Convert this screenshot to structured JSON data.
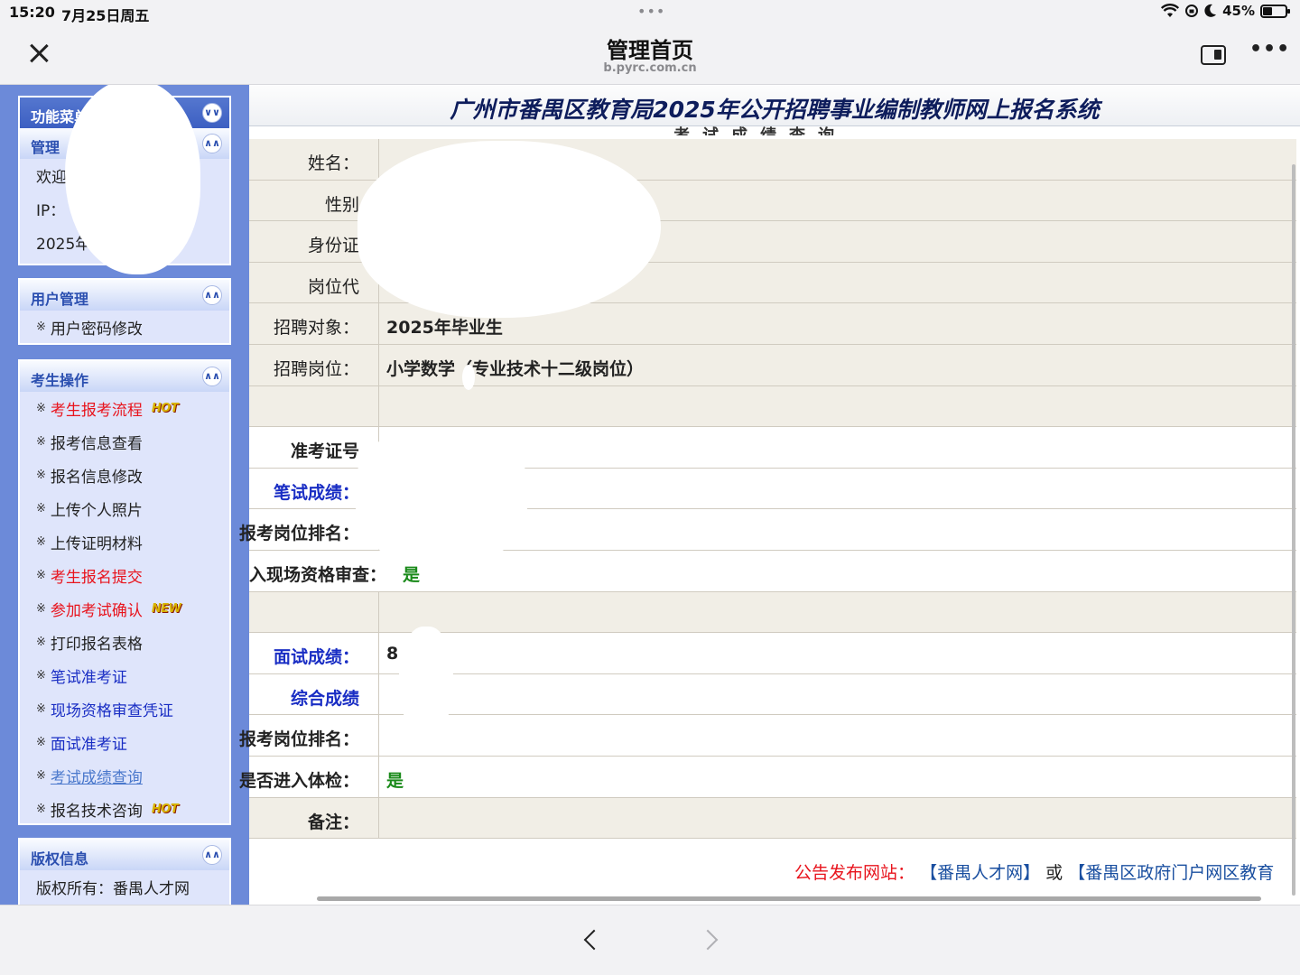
{
  "status": {
    "time": "15:20",
    "date": "7月25日周五",
    "dots": "•••",
    "battery_percent": "45%",
    "battery_level": 0.45
  },
  "browser": {
    "title": "管理首页",
    "url": "b.pyrc.com.cn",
    "more": "•••"
  },
  "sidebar": {
    "menu_title": "功能菜单",
    "admin_panel": {
      "title": "管理",
      "rows": [
        "欢迎",
        "IP：",
        "2025年"
      ]
    },
    "user_panel": {
      "title": "用户管理",
      "items": [
        "用户密码修改"
      ]
    },
    "exam_panel": {
      "title": "考生操作",
      "items": [
        {
          "label": "考生报考流程",
          "badge": "HOT"
        },
        {
          "label": "报考信息查看"
        },
        {
          "label": "报名信息修改"
        },
        {
          "label": "上传个人照片"
        },
        {
          "label": "上传证明材料"
        },
        {
          "label": "考生报名提交"
        },
        {
          "label": "参加考试确认",
          "badge": "NEW"
        },
        {
          "label": "打印报名表格"
        },
        {
          "label": "笔试准考证"
        },
        {
          "label": "现场资格审查凭证"
        },
        {
          "label": "面试准考证"
        },
        {
          "label": "考试成绩查询"
        },
        {
          "label": "报名技术咨询",
          "badge": "HOT"
        }
      ]
    },
    "copyright_panel": {
      "title": "版权信息",
      "text": "版权所有：番禺人才网"
    },
    "bullet": "※"
  },
  "main": {
    "banner_title": "广州市番禺区教育局2025年公开招聘事业编制教师网上报名系统",
    "subheading": "考试成绩查询",
    "rows": [
      {
        "label": "姓名：",
        "value": ""
      },
      {
        "label": "性别",
        "value": ""
      },
      {
        "label": "身份证",
        "value": ""
      },
      {
        "label": "岗位代",
        "value": ""
      },
      {
        "label": "招聘对象：",
        "value": "2025年毕业生"
      },
      {
        "label": "招聘岗位：",
        "value": "小学数学（专业技术十二级岗位）"
      },
      {
        "label": "",
        "value": ""
      },
      {
        "label": "准考证号",
        "value": ""
      },
      {
        "label": "笔试成绩：",
        "value": ""
      },
      {
        "label": "报考岗位排名：",
        "value": ""
      },
      {
        "label": "入现场资格审查：",
        "value": "是"
      },
      {
        "label": "",
        "value": ""
      },
      {
        "label": "面试成绩：",
        "value": "8"
      },
      {
        "label": "综合成绩",
        "value": ""
      },
      {
        "label": "报考岗位排名：",
        "value": ""
      },
      {
        "label": "是否进入体检：",
        "value": "是"
      },
      {
        "label": "备注：",
        "value": ""
      }
    ],
    "footer": {
      "label": "公告发布网站：",
      "link1": "【番禺人才网】",
      "or": "或",
      "link2": "【番禺区政府门户网区教育"
    }
  },
  "colors": {
    "sidebar_bg": "#6c8ad9",
    "panel_bg": "#dfe5fb",
    "row_tan": "#f1eee6",
    "link_red": "#e8141d",
    "link_blue": "#1a2ec4",
    "green": "#1a8a1a"
  }
}
